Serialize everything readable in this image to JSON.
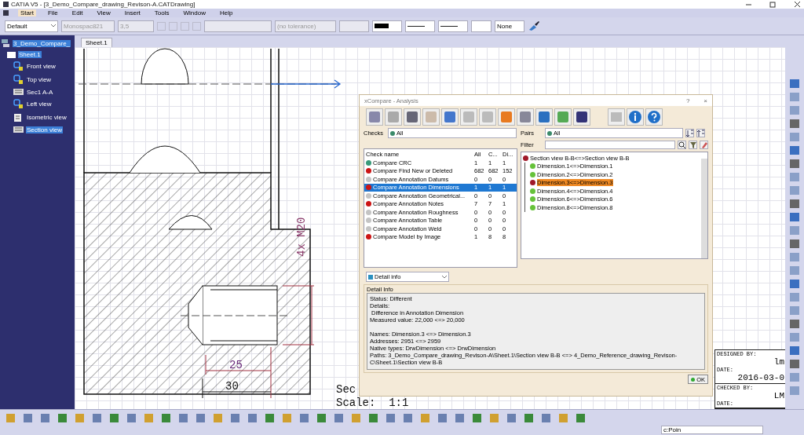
{
  "window": {
    "title": "CATIA V5 - [3_Demo_Compare_drawing_Revison-A.CATDrawing]"
  },
  "menu": [
    {
      "label": "Start",
      "selected": true
    },
    {
      "label": "File",
      "selected": false
    },
    {
      "label": "Edit",
      "selected": false
    },
    {
      "label": "View",
      "selected": false
    },
    {
      "label": "Insert",
      "selected": false
    },
    {
      "label": "Tools",
      "selected": false
    },
    {
      "label": "Window",
      "selected": false
    },
    {
      "label": "Help",
      "selected": false
    }
  ],
  "toolbar": {
    "style": "Default",
    "font": "Monospac821",
    "size": "3,5",
    "tolerance": "(no tolerance)",
    "pattern": "None"
  },
  "tree": {
    "label": "3_Demo_Compare_",
    "selected": true,
    "children": [
      {
        "label": "Sheet.1",
        "selected": true,
        "children": [
          {
            "label": "Front view",
            "kind": "view",
            "selected": false
          },
          {
            "label": "Top view",
            "kind": "view",
            "selected": false
          },
          {
            "label": "Sec1 A-A",
            "kind": "section",
            "selected": false
          },
          {
            "label": "Left view",
            "kind": "view",
            "selected": false
          },
          {
            "label": "Isometric view",
            "kind": "iso",
            "selected": false
          },
          {
            "label": "Section view",
            "kind": "section",
            "selected": true
          }
        ]
      }
    ]
  },
  "sheet_tab": "Sheet.1",
  "drawing": {
    "dim_25": "25",
    "dim_30": "30",
    "thread": "4x M20",
    "view_name": "Sec",
    "scale": "Scale:  1:1"
  },
  "title_block": {
    "designed_label": "DESIGNED BY:",
    "designed": "lm",
    "date_label": "DATE:",
    "date": "2016-03-0",
    "checked_label": "CHECKED BY:",
    "checked": "LM",
    "date2_label": "DATE:"
  },
  "dialog": {
    "title": "xCompare - Analysis",
    "help": "?",
    "close": "×",
    "checks": {
      "label": "Checks",
      "value": "All"
    },
    "table": {
      "columns": [
        "Check name",
        "All",
        "C...",
        "Di..."
      ],
      "rows": [
        {
          "color": "#3a9a7a",
          "cells": [
            "Compare CRC",
            "1",
            "1",
            "1"
          ],
          "selected": false
        },
        {
          "color": "#cc1414",
          "cells": [
            "Compare Find New or Deleted",
            "682",
            "682",
            "152"
          ],
          "selected": false
        },
        {
          "color": "#c4c4c4",
          "cells": [
            "Compare Annotation Datums",
            "0",
            "0",
            "0"
          ],
          "selected": false
        },
        {
          "color": "#cc1414",
          "cells": [
            "Compare Annotation Dimensions",
            "1",
            "1",
            "1"
          ],
          "selected": true
        },
        {
          "color": "#c4c4c4",
          "cells": [
            "Compare Annotation Geometrical...",
            "0",
            "0",
            "0"
          ],
          "selected": false
        },
        {
          "color": "#cc1414",
          "cells": [
            "Compare Annotation Notes",
            "7",
            "7",
            "1"
          ],
          "selected": false
        },
        {
          "color": "#c4c4c4",
          "cells": [
            "Compare Annotation Roughness",
            "0",
            "0",
            "0"
          ],
          "selected": false
        },
        {
          "color": "#c4c4c4",
          "cells": [
            "Compare Annotation Table",
            "0",
            "0",
            "0"
          ],
          "selected": false
        },
        {
          "color": "#c4c4c4",
          "cells": [
            "Compare Annotation Weld",
            "0",
            "0",
            "0"
          ],
          "selected": false
        },
        {
          "color": "#cc1414",
          "cells": [
            "Compare Model by Image",
            "1",
            "8",
            "8"
          ],
          "selected": false
        }
      ]
    },
    "pairs": {
      "label": "Pairs",
      "value": "All",
      "filter_label": "Filter"
    },
    "pair_tree": {
      "label": "Section view B-B<=>Section view B-B",
      "color": "#a01828",
      "children": [
        {
          "label": "Dimension.1<=>Dimension.1",
          "color": "#66c23a",
          "selected": false
        },
        {
          "label": "Dimension.2<=>Dimension.2",
          "color": "#66c23a",
          "selected": false
        },
        {
          "label": "Dimension.3<=>Dimension.3",
          "color": "#a01828",
          "selected": true
        },
        {
          "label": "Dimension.4<=>Dimension.4",
          "color": "#66c23a",
          "selected": false
        },
        {
          "label": "Dimension.6<=>Dimension.6",
          "color": "#66c23a",
          "selected": false
        },
        {
          "label": "Dimension.8<=>Dimension.8",
          "color": "#66c23a",
          "selected": false
        }
      ]
    },
    "detail_mode": "Detail info",
    "detail_group": "Detail Info",
    "detail_paragraphs": [
      [
        "Status: Different",
        "Details:",
        " Difference in Annotation Dimension",
        "Measured value: 22,000 <=> 20,000"
      ],
      [
        "Names: Dimension.3 <=> Dimension.3",
        "Addresses: 2951 <=> 2959",
        "Native types: DrwDimension <=> DrwDimension",
        "Paths: 3_Demo_Compare_drawing_Revison-A\\Sheet.1\\Section view B-B <=> 4_Demo_Reference_drawing_Revison-C\\Sheet.1\\Section view B-B"
      ]
    ],
    "ok": "OK"
  },
  "status_bar": {
    "command": "c:Poin"
  }
}
